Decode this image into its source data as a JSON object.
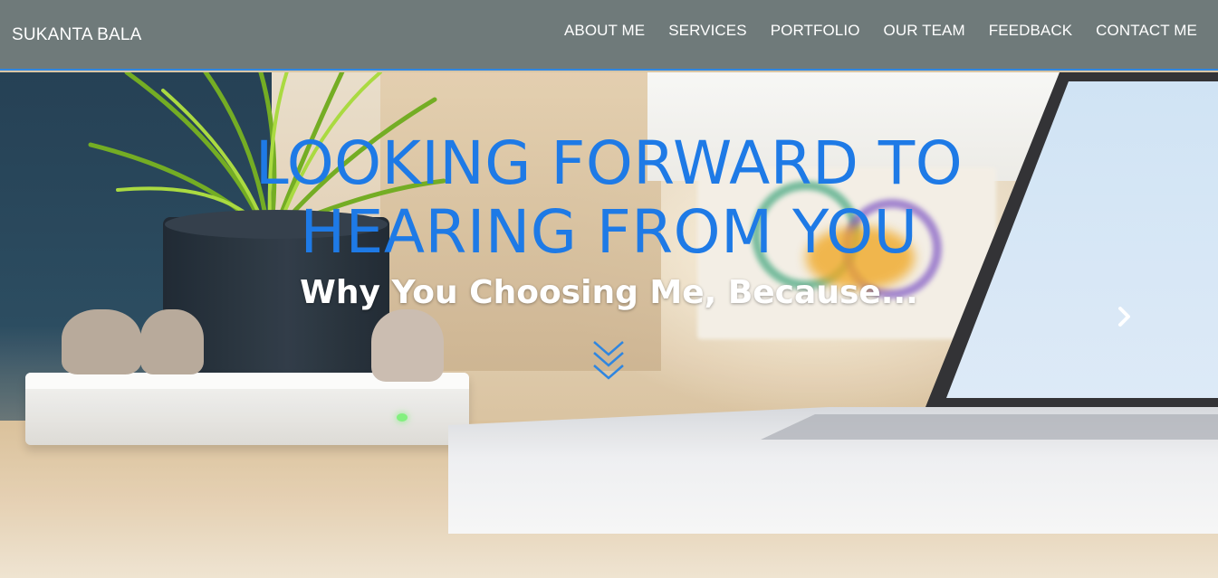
{
  "header": {
    "brand": "SUKANTA BALA",
    "nav": [
      "ABOUT ME",
      "SERVICES",
      "PORTFOLIO",
      "OUR TEAM",
      "FEEDBACK",
      "CONTACT ME"
    ]
  },
  "hero": {
    "headline_line1": "LOOKING FORWARD TO",
    "headline_line2": "HEARING FROM YOU",
    "subheadline": "Why You Choosing Me, Because..."
  },
  "icons": {
    "next": "chevron-right-icon",
    "scroll": "double-chevron-down-icon"
  },
  "colors": {
    "navbar_bg": "#6f7a7a",
    "navbar_border": "#2f86e0",
    "headline": "#1e7ae6",
    "subheadline": "#ffffff"
  }
}
